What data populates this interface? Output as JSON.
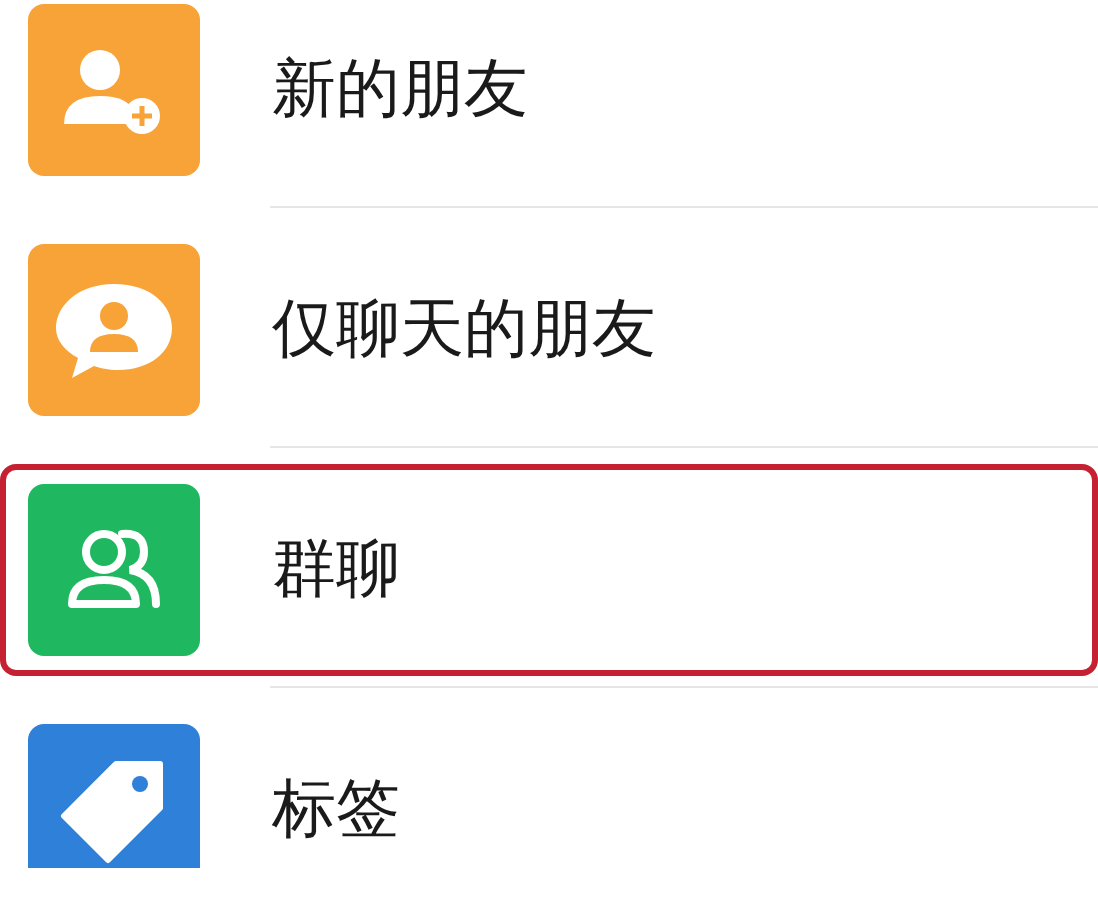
{
  "items": [
    {
      "label": "新的朋友",
      "kind": "add-friend",
      "color": "#f7a338",
      "selected": false
    },
    {
      "label": "仅聊天的朋友",
      "kind": "chat-only",
      "color": "#f7a338",
      "selected": false
    },
    {
      "label": "群聊",
      "kind": "group",
      "color": "#1fb860",
      "selected": true
    },
    {
      "label": "标签",
      "kind": "tag",
      "color": "#2f80d8",
      "selected": false
    }
  ]
}
